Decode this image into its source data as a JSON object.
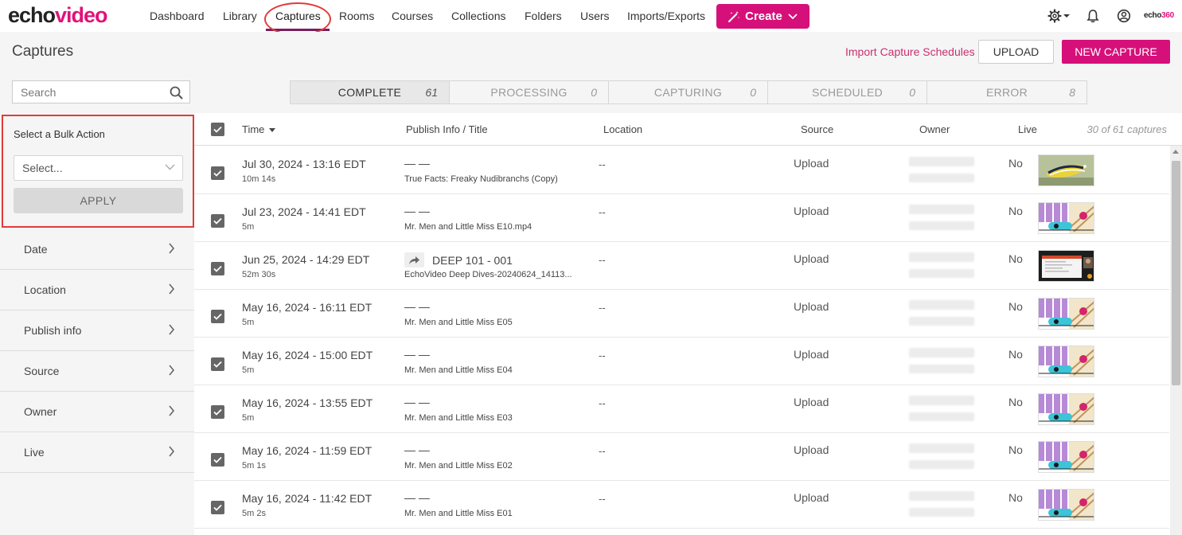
{
  "app": {
    "logo_echo": "echo",
    "logo_video": "video",
    "brand_small_a": "echo",
    "brand_small_b": "360"
  },
  "nav": {
    "items": [
      {
        "label": "Dashboard"
      },
      {
        "label": "Library"
      },
      {
        "label": "Captures"
      },
      {
        "label": "Rooms"
      },
      {
        "label": "Courses"
      },
      {
        "label": "Collections"
      },
      {
        "label": "Folders"
      },
      {
        "label": "Users"
      },
      {
        "label": "Imports/Exports"
      }
    ],
    "active": "Captures",
    "create_label": "Create"
  },
  "header": {
    "title": "Captures",
    "import_link": "Import Capture Schedules",
    "upload_label": "UPLOAD",
    "new_capture_label": "NEW CAPTURE"
  },
  "search": {
    "placeholder": "Search",
    "value": ""
  },
  "status_tabs": [
    {
      "label": "COMPLETE",
      "count": "61"
    },
    {
      "label": "PROCESSING",
      "count": "0"
    },
    {
      "label": "CAPTURING",
      "count": "0"
    },
    {
      "label": "SCHEDULED",
      "count": "0"
    },
    {
      "label": "ERROR",
      "count": "8"
    }
  ],
  "bulk": {
    "title": "Select a Bulk Action",
    "select_value": "Select...",
    "apply_label": "APPLY"
  },
  "filters": [
    {
      "label": "Date"
    },
    {
      "label": "Location"
    },
    {
      "label": "Publish info"
    },
    {
      "label": "Source"
    },
    {
      "label": "Owner"
    },
    {
      "label": "Live"
    }
  ],
  "table": {
    "columns": {
      "time": "Time",
      "publish": "Publish Info / Title",
      "location": "Location",
      "source": "Source",
      "owner": "Owner",
      "live": "Live"
    },
    "count_text": "30 of 61 captures",
    "rows": [
      {
        "date": "Jul 30, 2024 - 13:16 EDT",
        "duration": "10m 14s",
        "publish": "— —",
        "title": "True Facts: Freaky Nudibranchs (Copy)",
        "location": "--",
        "source": "Upload",
        "live": "No",
        "thumb": "nudibranch"
      },
      {
        "date": "Jul 23, 2024 - 14:41 EDT",
        "duration": "5m",
        "publish": "— —",
        "title": "Mr. Men and Little Miss E10.mp4",
        "location": "--",
        "source": "Upload",
        "live": "No",
        "thumb": "cartoon"
      },
      {
        "date": "Jun 25, 2024 - 14:29 EDT",
        "duration": "52m 30s",
        "publish": "DEEP 101 - 001",
        "title": "EchoVideo Deep Dives-20240624_14113...",
        "location": "--",
        "source": "Upload",
        "live": "No",
        "thumb": "screen",
        "shared": true
      },
      {
        "date": "May 16, 2024 - 16:11 EDT",
        "duration": "5m",
        "publish": "— —",
        "title": "Mr. Men and Little Miss E05",
        "location": "--",
        "source": "Upload",
        "live": "No",
        "thumb": "cartoon"
      },
      {
        "date": "May 16, 2024 - 15:00 EDT",
        "duration": "5m",
        "publish": "— —",
        "title": "Mr. Men and Little Miss E04",
        "location": "--",
        "source": "Upload",
        "live": "No",
        "thumb": "cartoon"
      },
      {
        "date": "May 16, 2024 - 13:55 EDT",
        "duration": "5m",
        "publish": "— —",
        "title": "Mr. Men and Little Miss E03",
        "location": "--",
        "source": "Upload",
        "live": "No",
        "thumb": "cartoon"
      },
      {
        "date": "May 16, 2024 - 11:59 EDT",
        "duration": "5m 1s",
        "publish": "— —",
        "title": "Mr. Men and Little Miss E02",
        "location": "--",
        "source": "Upload",
        "live": "No",
        "thumb": "cartoon"
      },
      {
        "date": "May 16, 2024 - 11:42 EDT",
        "duration": "5m 2s",
        "publish": "— —",
        "title": "Mr. Men and Little Miss E01",
        "location": "--",
        "source": "Upload",
        "live": "No",
        "thumb": "cartoon"
      }
    ]
  },
  "colors": {
    "brand": "#d6107a",
    "link": "#c8306e",
    "annotation": "#e23b3b"
  }
}
